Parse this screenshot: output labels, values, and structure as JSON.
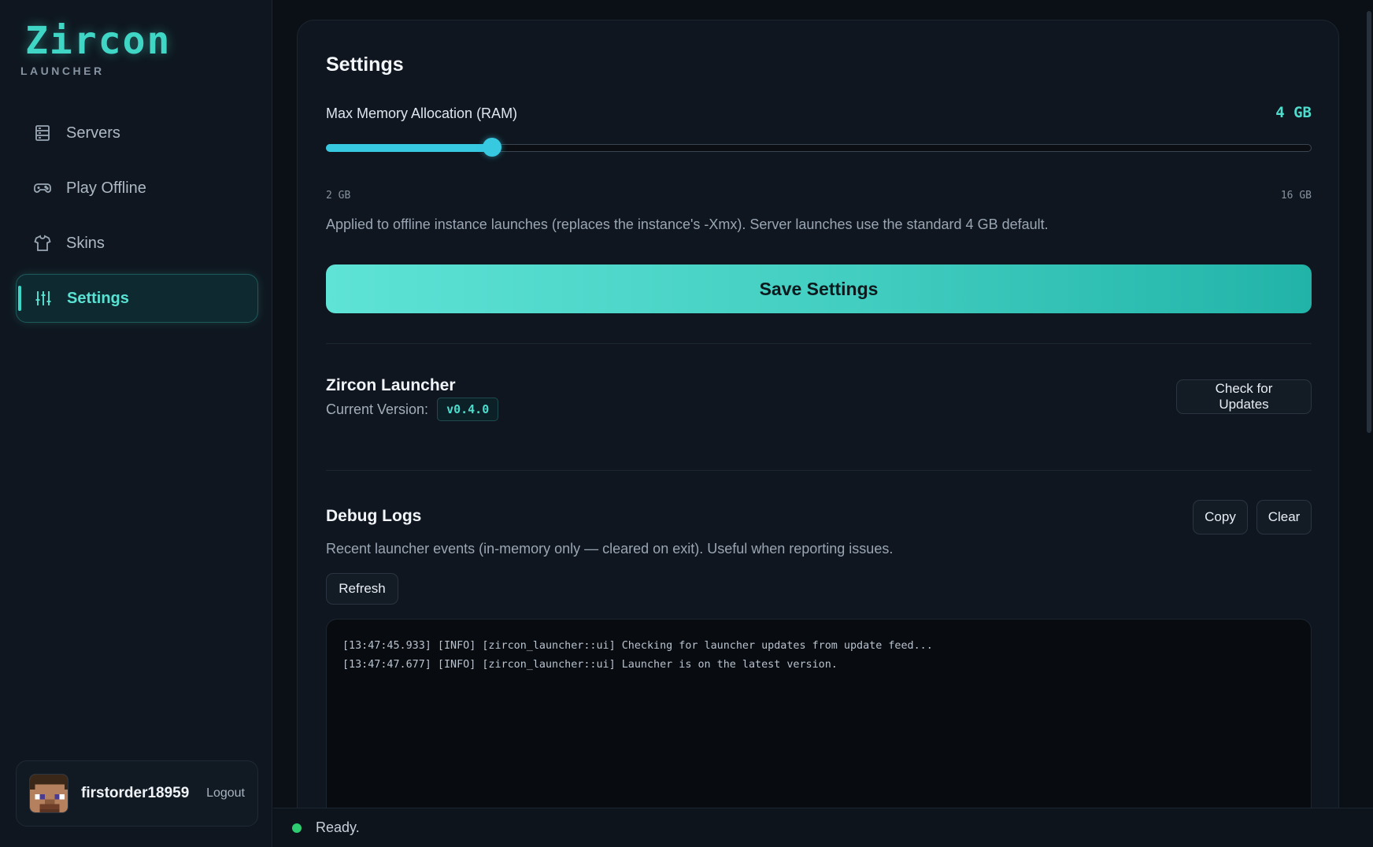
{
  "brand": {
    "name": "Zircon",
    "subtitle": "LAUNCHER",
    "accent": "#40d6c6"
  },
  "sidebar": {
    "items": [
      {
        "label": "Servers",
        "icon": "server-stack-icon",
        "active": false
      },
      {
        "label": "Play Offline",
        "icon": "gamepad-icon",
        "active": false
      },
      {
        "label": "Skins",
        "icon": "shirt-icon",
        "active": false
      },
      {
        "label": "Settings",
        "icon": "sliders-icon",
        "active": true
      }
    ]
  },
  "user": {
    "name": "firstorder18959",
    "logout_label": "Logout",
    "avatar": "pixel-face-avatar"
  },
  "settings": {
    "title": "Settings",
    "ram": {
      "label": "Max Memory Allocation (RAM)",
      "value_display": "4 GB",
      "min_label": "2 GB",
      "max_label": "16 GB",
      "min": 2,
      "max": 16,
      "value": 4,
      "help": "Applied to offline instance launches (replaces the instance's -Xmx). Server launches use the standard 4 GB default."
    },
    "save_label": "Save Settings"
  },
  "about": {
    "title": "Zircon Launcher",
    "version_label": "Current Version:",
    "version": "v0.4.0",
    "check_updates_label": "Check for Updates"
  },
  "logs": {
    "title": "Debug Logs",
    "description": "Recent launcher events (in-memory only — cleared on exit). Useful when reporting issues.",
    "copy_label": "Copy",
    "clear_label": "Clear",
    "refresh_label": "Refresh",
    "lines": [
      "[13:47:45.933] [INFO] [zircon_launcher::ui] Checking for launcher updates from update feed...",
      "[13:47:47.677] [INFO] [zircon_launcher::ui] Launcher is on the latest version."
    ]
  },
  "status": {
    "text": "Ready.",
    "color": "#2ecc71"
  }
}
